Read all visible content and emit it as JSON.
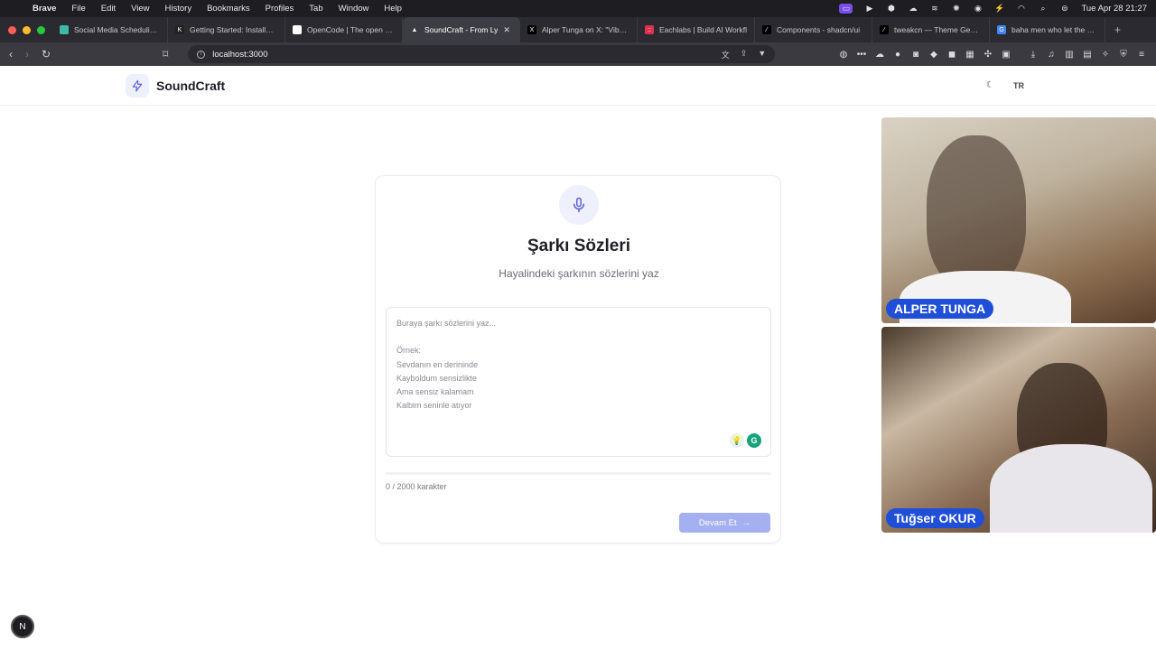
{
  "menubar": {
    "app": "Brave",
    "items": [
      "File",
      "Edit",
      "View",
      "History",
      "Bookmarks",
      "Profiles",
      "Tab",
      "Window",
      "Help"
    ],
    "clock": "Tue Apr 28  21:27"
  },
  "tabs": [
    {
      "label": "Social Media Scheduling S",
      "color": "#3fb8a8",
      "glyph": ""
    },
    {
      "label": "Getting Started: Installatio",
      "color": "#222222",
      "glyph": "K"
    },
    {
      "label": "OpenCode | The open sou",
      "color": "#ffffff",
      "glyph": ""
    },
    {
      "label": "SoundCraft - From Ly",
      "color": "#ffffff",
      "glyph": "▲",
      "active": true
    },
    {
      "label": "Alper Tunga on X: \"Vibe C",
      "color": "#000000",
      "glyph": "X"
    },
    {
      "label": "Eachlabs | Build AI Workfl",
      "color": "#e03050",
      "glyph": "::"
    },
    {
      "label": "Components - shadcn/ui",
      "color": "#000000",
      "glyph": "⁄"
    },
    {
      "label": "tweakcn — Theme Genera",
      "color": "#000000",
      "glyph": "⁄"
    },
    {
      "label": "baha men who let the dog",
      "color": "#4285f4",
      "glyph": "G"
    }
  ],
  "address": {
    "url": "localhost:3000"
  },
  "header": {
    "brand": "SoundCraft",
    "lang": "TR"
  },
  "card": {
    "title": "Şarkı Sözleri",
    "subtitle": "Hayalindeki şarkının sözlerini yaz",
    "placeholder": "Buraya şarkı sözlerini yaz...\n\nÖrnek:\nSevdanın en derininde\nKayboldum sensizlikte\nAma sensiz kalamam\nKalbim seninle atıyor",
    "char_count": "0 / 2000 karakter",
    "continue_label": "Devam Et"
  },
  "participants": [
    {
      "name": "ALPER TUNGA"
    },
    {
      "name": "Tuğser OKUR"
    }
  ],
  "colors": {
    "accent": "#6366f1",
    "button_disabled": "#a5b0f0",
    "badge": "#1f4fd6"
  }
}
